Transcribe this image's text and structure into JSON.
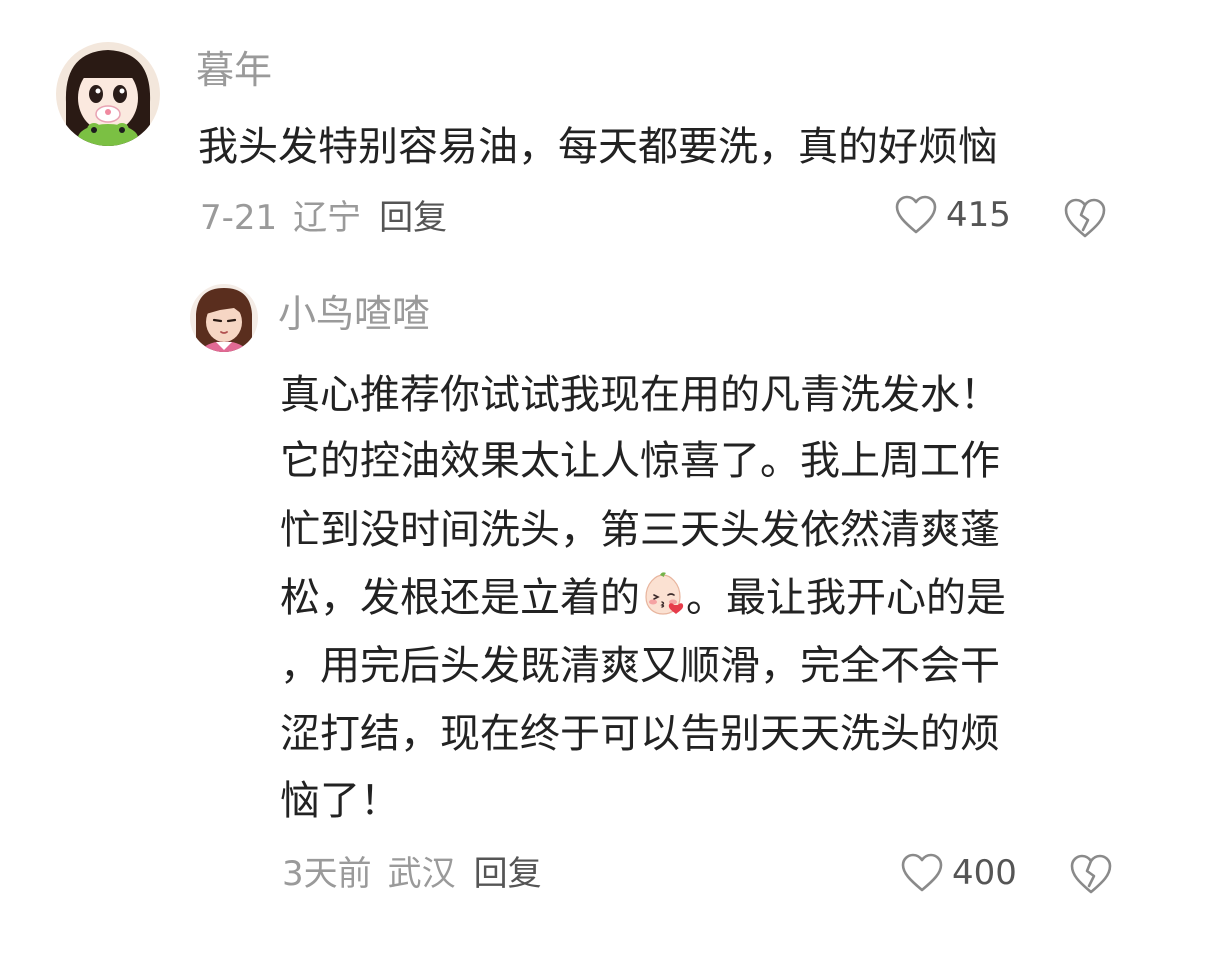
{
  "comments": [
    {
      "user": "暮年",
      "text": "我头发特别容易油，每天都要洗，真的好烦恼",
      "date": "7-21",
      "location": "辽宁",
      "reply_label": "回复",
      "likes": "415"
    }
  ],
  "reply": {
    "user": "小鸟喳喳",
    "lines": [
      "真心推荐你试试我现在用的凡青洗发水！",
      "它的控油效果太让人惊喜了。我上周工作",
      "忙到没时间洗头，第三天头发依然清爽蓬",
      "松，发根还是立着的",
      "。最让我开心的是",
      "，用完后头发既清爽又顺滑，完全不会干",
      "涩打结，现在终于可以告别天天洗头的烦",
      "恼了！"
    ],
    "date": "3天前",
    "location": "武汉",
    "reply_label": "回复",
    "likes": "400"
  },
  "icons": {
    "like": "heart-outline-icon",
    "dislike": "broken-heart-outline-icon",
    "emoji": "blushing-kiss-emoji"
  },
  "colors": {
    "text": "#222222",
    "muted": "#9a9a9a",
    "reply": "#555555"
  }
}
